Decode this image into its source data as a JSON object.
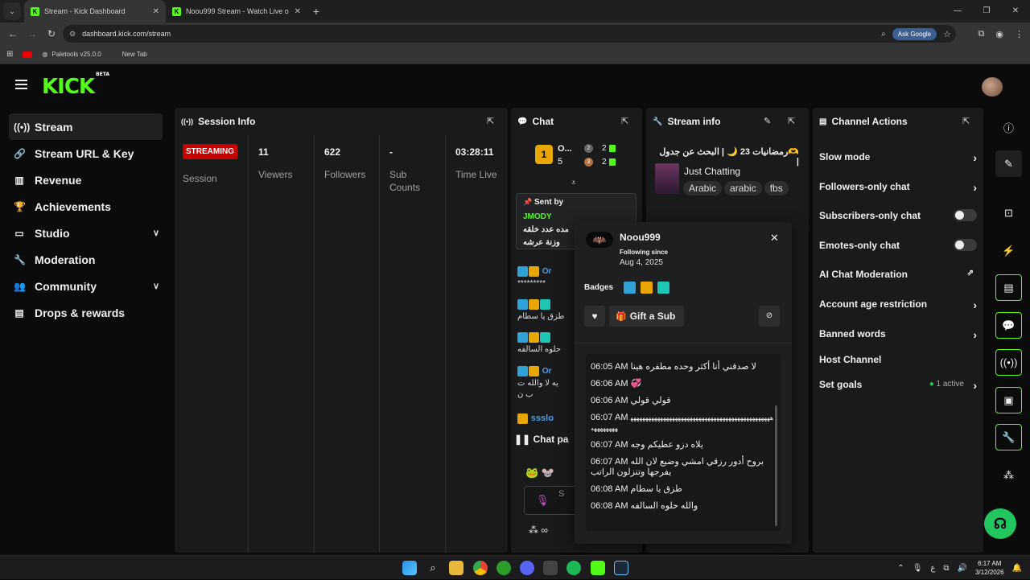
{
  "browser": {
    "tabs": [
      {
        "title": "Stream - Kick Dashboard",
        "active": true
      },
      {
        "title": "Noou999 Stream - Watch Live o",
        "active": false
      }
    ],
    "url": "dashboard.kick.com/stream",
    "ask_google": "Ask Google",
    "bookmarks": [
      "Paletools v25.0.0",
      "New Tab"
    ]
  },
  "app": {
    "logo": "KICK",
    "logo_badge": "BETA"
  },
  "sidebar": {
    "items": [
      {
        "label": "Stream",
        "icon": "broadcast-icon"
      },
      {
        "label": "Stream URL & Key",
        "icon": "link-icon"
      },
      {
        "label": "Revenue",
        "icon": "chart-icon"
      },
      {
        "label": "Achievements",
        "icon": "trophy-icon"
      },
      {
        "label": "Studio",
        "icon": "studio-icon"
      },
      {
        "label": "Moderation",
        "icon": "wrench-icon"
      },
      {
        "label": "Community",
        "icon": "community-icon"
      },
      {
        "label": "Drops & rewards",
        "icon": "gift-icon"
      }
    ]
  },
  "session": {
    "title": "Session Info",
    "status": "STREAMING",
    "status_label": "Session",
    "viewers": "11",
    "viewers_label": "Viewers",
    "followers": "622",
    "followers_label": "Followers",
    "subs": "-",
    "subs_label": "Sub Counts",
    "time_live": "03:28:11",
    "time_live_label": "Time Live"
  },
  "chat": {
    "title": "Chat",
    "leaderboard": {
      "first_name": "O...",
      "first_count": "5",
      "second_count": "2",
      "third_count": "2",
      "rank1": "1",
      "rank2": "2",
      "rank3": "3"
    },
    "pinned": {
      "label": "Sent by",
      "user": "JMODY",
      "line1": "مده عدد خلقه",
      "line2": "وزنة عرشه"
    },
    "messages": [
      {
        "user": "Or",
        "text": "*********"
      },
      {
        "user": "Or",
        "text": "طزق يا سطام"
      },
      {
        "user": "",
        "text": "حلوه السالفه"
      },
      {
        "user": "Or",
        "text": "يه لا والله ت"
      },
      {
        "user": "",
        "text": "ب ن"
      }
    ],
    "last_user": "ssslo",
    "paused_label": "Chat pa",
    "input_placeholder": "S"
  },
  "stream_info": {
    "title": "Stream info",
    "stream_title": "🫶رمضانيات 23 🌙 | البحث عن جدول |",
    "category": "Just Chatting",
    "tags": [
      "Arabic",
      "arabic",
      "fbs"
    ]
  },
  "channel_actions": {
    "title": "Channel Actions",
    "items": [
      {
        "label": "Slow mode",
        "control": "chevron"
      },
      {
        "label": "Followers-only chat",
        "control": "chevron"
      },
      {
        "label": "Subscribers-only chat",
        "control": "toggle"
      },
      {
        "label": "Emotes-only chat",
        "control": "toggle"
      },
      {
        "label": "AI Chat Moderation",
        "control": "external"
      },
      {
        "label": "Account age restriction",
        "control": "chevron"
      },
      {
        "label": "Banned words",
        "control": "chevron"
      },
      {
        "label": "Host Channel",
        "control": "none"
      },
      {
        "label": "Set goals",
        "control": "chevron"
      }
    ],
    "goals_active": "1 active"
  },
  "user_card": {
    "username": "Noou999",
    "following_label": "Following since",
    "following_date": "Aug 4, 2025",
    "badges_label": "Badges",
    "gift_label": "Gift a Sub",
    "messages": [
      {
        "time": "06:05 AM",
        "text": "لا صدقني أنا أكثر وحده مطفره هينا"
      },
      {
        "time": "06:06 AM",
        "text": "💞"
      },
      {
        "time": "06:06 AM",
        "text": "قولي قولي"
      },
      {
        "time": "06:07 AM",
        "text": "ههههههههههههههههههههههههههههههههههههههههههههههههههههههههه"
      },
      {
        "time": "06:07 AM",
        "text": "يلاه دزو عطيكم وجه"
      },
      {
        "time": "06:07 AM",
        "text": "بروح أدور رزقي امشي وضيع لان الله يفرجها وتنزلون الراتب"
      },
      {
        "time": "06:08 AM",
        "text": "طزق يا سطام"
      },
      {
        "time": "06:08 AM",
        "text": "والله حلوه السالفه"
      }
    ]
  },
  "taskbar": {
    "time": "6:17 AM",
    "date": "3/12/2026",
    "lang": "ع"
  },
  "colors": {
    "brand": "#53fc18",
    "streaming": "#c90000",
    "panel": "#191a1b",
    "background": "#0b0b0c"
  }
}
